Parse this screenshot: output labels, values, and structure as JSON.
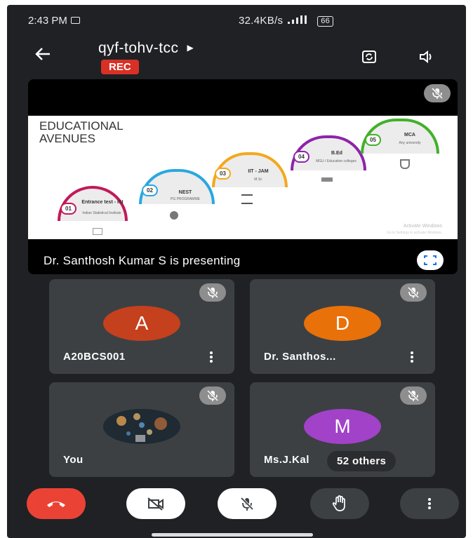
{
  "status_bar": {
    "time": "2:43 PM",
    "network_speed": "32.4KB/s",
    "battery": "66"
  },
  "header": {
    "meeting_code": "qyf-tohv-tcc",
    "recording_badge": "REC"
  },
  "presentation": {
    "slide_title_line1": "EDUCATIONAL",
    "slide_title_line2": "AVENUES",
    "steps": [
      {
        "num": "01",
        "label": "Entrance test - ISI",
        "sub": "Indian Statistical Institute",
        "color": "#c2185b"
      },
      {
        "num": "02",
        "label": "NEST",
        "sub": "PG PROGRAMME",
        "color": "#29a8e0"
      },
      {
        "num": "03",
        "label": "IIT - JAM",
        "sub": "M.Sc",
        "color": "#f4a81d"
      },
      {
        "num": "04",
        "label": "B.Ed",
        "sub": "MGU / Education colleges",
        "color": "#8e24aa"
      },
      {
        "num": "05",
        "label": "MCA",
        "sub": "Any university",
        "color": "#43b02a"
      }
    ],
    "watermark_line1": "Activate Windows",
    "watermark_line2": "Go to Settings to activate Windows.",
    "presenter_text": "Dr. Santhosh Kumar S is presenting"
  },
  "participants": [
    {
      "initial": "A",
      "name": "A20BCS001",
      "avatar_color": "#c5401d"
    },
    {
      "initial": "D",
      "name": "Dr. Santhos...",
      "avatar_color": "#e8710a"
    },
    {
      "initial": "",
      "name": "You",
      "avatar_color": "#1f2a33"
    },
    {
      "initial": "M",
      "name": "Ms.J.Kal",
      "avatar_color": "#a142c8"
    }
  ],
  "others_chip": "52 others",
  "colors": {
    "end_call": "#ea4335",
    "background": "#202124",
    "tile": "#3c4043"
  }
}
